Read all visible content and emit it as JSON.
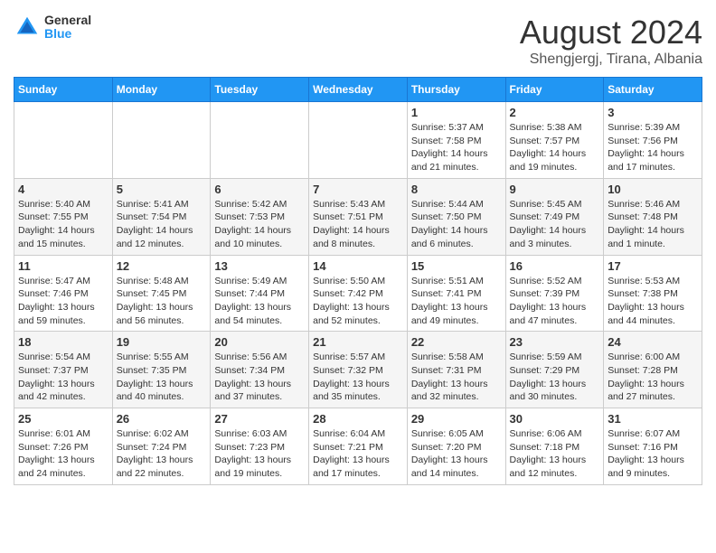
{
  "logo": {
    "general": "General",
    "blue": "Blue"
  },
  "title": "August 2024",
  "location": "Shengjergj, Tirana, Albania",
  "days_of_week": [
    "Sunday",
    "Monday",
    "Tuesday",
    "Wednesday",
    "Thursday",
    "Friday",
    "Saturday"
  ],
  "weeks": [
    [
      {
        "day": "",
        "info": ""
      },
      {
        "day": "",
        "info": ""
      },
      {
        "day": "",
        "info": ""
      },
      {
        "day": "",
        "info": ""
      },
      {
        "day": "1",
        "info": "Sunrise: 5:37 AM\nSunset: 7:58 PM\nDaylight: 14 hours and 21 minutes."
      },
      {
        "day": "2",
        "info": "Sunrise: 5:38 AM\nSunset: 7:57 PM\nDaylight: 14 hours and 19 minutes."
      },
      {
        "day": "3",
        "info": "Sunrise: 5:39 AM\nSunset: 7:56 PM\nDaylight: 14 hours and 17 minutes."
      }
    ],
    [
      {
        "day": "4",
        "info": "Sunrise: 5:40 AM\nSunset: 7:55 PM\nDaylight: 14 hours and 15 minutes."
      },
      {
        "day": "5",
        "info": "Sunrise: 5:41 AM\nSunset: 7:54 PM\nDaylight: 14 hours and 12 minutes."
      },
      {
        "day": "6",
        "info": "Sunrise: 5:42 AM\nSunset: 7:53 PM\nDaylight: 14 hours and 10 minutes."
      },
      {
        "day": "7",
        "info": "Sunrise: 5:43 AM\nSunset: 7:51 PM\nDaylight: 14 hours and 8 minutes."
      },
      {
        "day": "8",
        "info": "Sunrise: 5:44 AM\nSunset: 7:50 PM\nDaylight: 14 hours and 6 minutes."
      },
      {
        "day": "9",
        "info": "Sunrise: 5:45 AM\nSunset: 7:49 PM\nDaylight: 14 hours and 3 minutes."
      },
      {
        "day": "10",
        "info": "Sunrise: 5:46 AM\nSunset: 7:48 PM\nDaylight: 14 hours and 1 minute."
      }
    ],
    [
      {
        "day": "11",
        "info": "Sunrise: 5:47 AM\nSunset: 7:46 PM\nDaylight: 13 hours and 59 minutes."
      },
      {
        "day": "12",
        "info": "Sunrise: 5:48 AM\nSunset: 7:45 PM\nDaylight: 13 hours and 56 minutes."
      },
      {
        "day": "13",
        "info": "Sunrise: 5:49 AM\nSunset: 7:44 PM\nDaylight: 13 hours and 54 minutes."
      },
      {
        "day": "14",
        "info": "Sunrise: 5:50 AM\nSunset: 7:42 PM\nDaylight: 13 hours and 52 minutes."
      },
      {
        "day": "15",
        "info": "Sunrise: 5:51 AM\nSunset: 7:41 PM\nDaylight: 13 hours and 49 minutes."
      },
      {
        "day": "16",
        "info": "Sunrise: 5:52 AM\nSunset: 7:39 PM\nDaylight: 13 hours and 47 minutes."
      },
      {
        "day": "17",
        "info": "Sunrise: 5:53 AM\nSunset: 7:38 PM\nDaylight: 13 hours and 44 minutes."
      }
    ],
    [
      {
        "day": "18",
        "info": "Sunrise: 5:54 AM\nSunset: 7:37 PM\nDaylight: 13 hours and 42 minutes."
      },
      {
        "day": "19",
        "info": "Sunrise: 5:55 AM\nSunset: 7:35 PM\nDaylight: 13 hours and 40 minutes."
      },
      {
        "day": "20",
        "info": "Sunrise: 5:56 AM\nSunset: 7:34 PM\nDaylight: 13 hours and 37 minutes."
      },
      {
        "day": "21",
        "info": "Sunrise: 5:57 AM\nSunset: 7:32 PM\nDaylight: 13 hours and 35 minutes."
      },
      {
        "day": "22",
        "info": "Sunrise: 5:58 AM\nSunset: 7:31 PM\nDaylight: 13 hours and 32 minutes."
      },
      {
        "day": "23",
        "info": "Sunrise: 5:59 AM\nSunset: 7:29 PM\nDaylight: 13 hours and 30 minutes."
      },
      {
        "day": "24",
        "info": "Sunrise: 6:00 AM\nSunset: 7:28 PM\nDaylight: 13 hours and 27 minutes."
      }
    ],
    [
      {
        "day": "25",
        "info": "Sunrise: 6:01 AM\nSunset: 7:26 PM\nDaylight: 13 hours and 24 minutes."
      },
      {
        "day": "26",
        "info": "Sunrise: 6:02 AM\nSunset: 7:24 PM\nDaylight: 13 hours and 22 minutes."
      },
      {
        "day": "27",
        "info": "Sunrise: 6:03 AM\nSunset: 7:23 PM\nDaylight: 13 hours and 19 minutes."
      },
      {
        "day": "28",
        "info": "Sunrise: 6:04 AM\nSunset: 7:21 PM\nDaylight: 13 hours and 17 minutes."
      },
      {
        "day": "29",
        "info": "Sunrise: 6:05 AM\nSunset: 7:20 PM\nDaylight: 13 hours and 14 minutes."
      },
      {
        "day": "30",
        "info": "Sunrise: 6:06 AM\nSunset: 7:18 PM\nDaylight: 13 hours and 12 minutes."
      },
      {
        "day": "31",
        "info": "Sunrise: 6:07 AM\nSunset: 7:16 PM\nDaylight: 13 hours and 9 minutes."
      }
    ]
  ]
}
